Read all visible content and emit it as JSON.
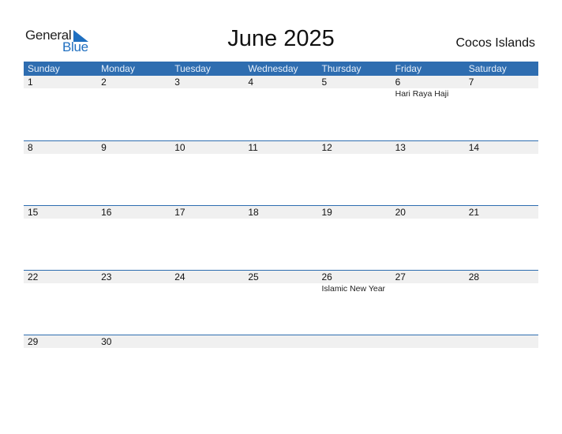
{
  "logo": {
    "line1": "General",
    "line2": "Blue",
    "accent": "#1f6fc0"
  },
  "title": "June 2025",
  "country": "Cocos Islands",
  "colors": {
    "header": "#2e6db0",
    "strip": "#f0f0f0"
  },
  "weekdays": [
    "Sunday",
    "Monday",
    "Tuesday",
    "Wednesday",
    "Thursday",
    "Friday",
    "Saturday"
  ],
  "weeks": [
    {
      "days": [
        "1",
        "2",
        "3",
        "4",
        "5",
        "6",
        "7"
      ],
      "events": [
        "",
        "",
        "",
        "",
        "",
        "Hari Raya Haji",
        ""
      ]
    },
    {
      "days": [
        "8",
        "9",
        "10",
        "11",
        "12",
        "13",
        "14"
      ],
      "events": [
        "",
        "",
        "",
        "",
        "",
        "",
        ""
      ]
    },
    {
      "days": [
        "15",
        "16",
        "17",
        "18",
        "19",
        "20",
        "21"
      ],
      "events": [
        "",
        "",
        "",
        "",
        "",
        "",
        ""
      ]
    },
    {
      "days": [
        "22",
        "23",
        "24",
        "25",
        "26",
        "27",
        "28"
      ],
      "events": [
        "",
        "",
        "",
        "",
        "Islamic New Year",
        "",
        ""
      ]
    },
    {
      "days": [
        "29",
        "30",
        "",
        "",
        "",
        "",
        ""
      ],
      "events": [
        "",
        "",
        "",
        "",
        "",
        "",
        ""
      ]
    }
  ]
}
